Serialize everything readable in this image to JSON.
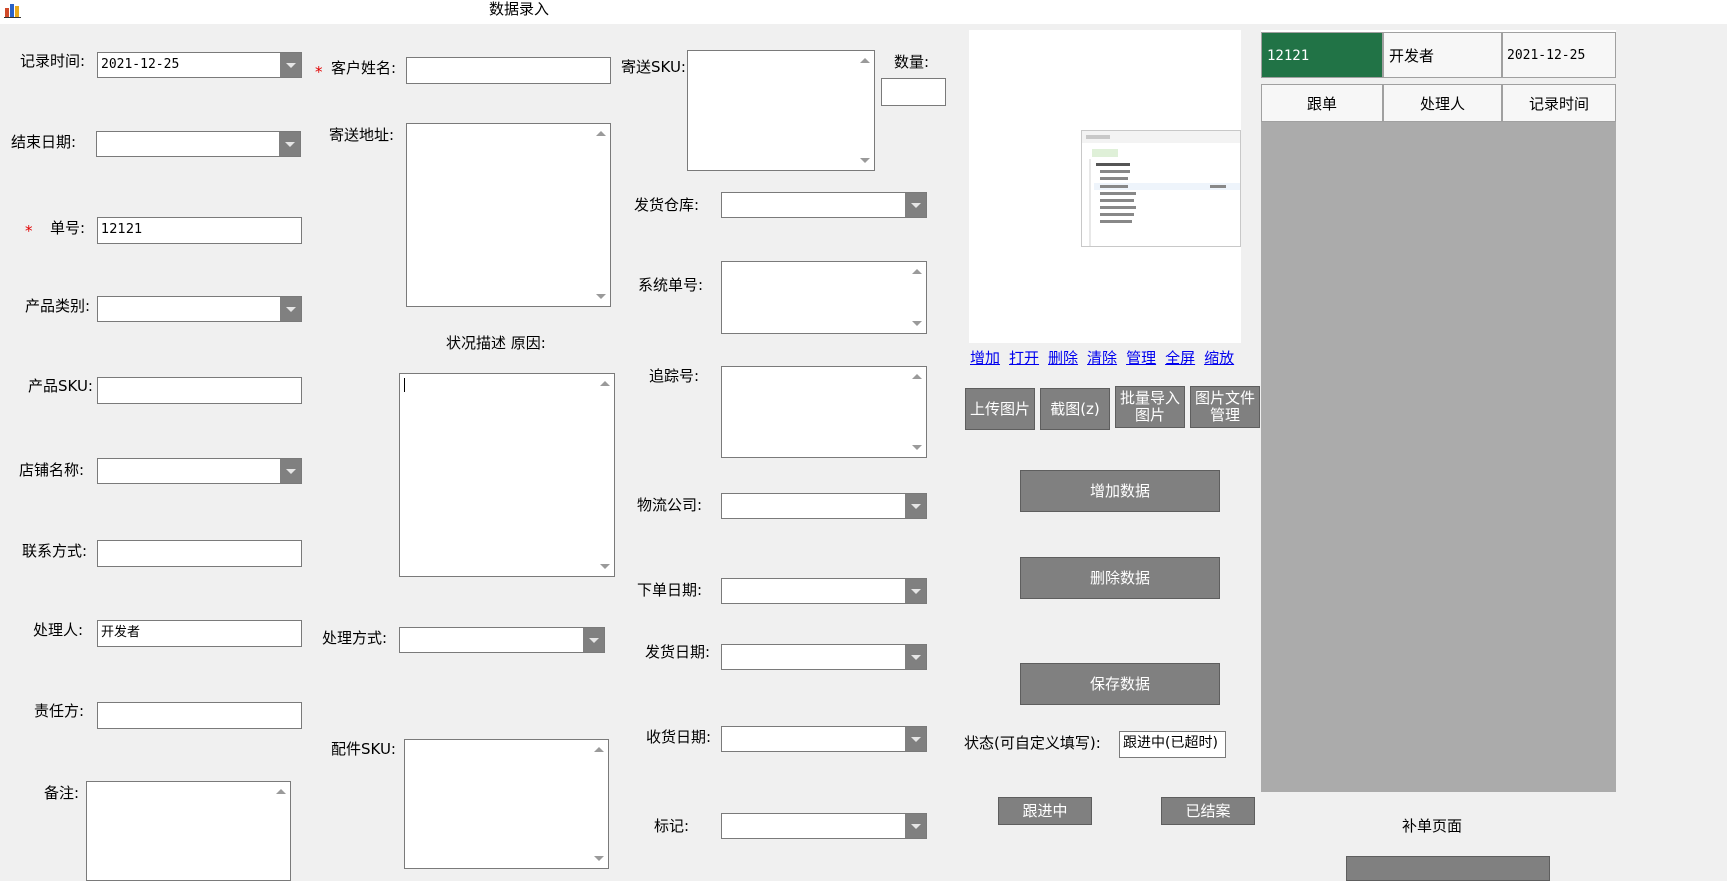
{
  "window": {
    "title": "数据录入"
  },
  "form": {
    "record_time": {
      "label": "记录时间:",
      "value": "2021-12-25"
    },
    "end_date": {
      "label": "结束日期:",
      "value": ""
    },
    "order_no": {
      "label": "单号:",
      "required_mark": "*",
      "value": "12121"
    },
    "product_category": {
      "label": "产品类别:",
      "value": ""
    },
    "product_sku": {
      "label": "产品SKU:",
      "value": ""
    },
    "shop_name": {
      "label": "店铺名称:",
      "value": ""
    },
    "contact": {
      "label": "联系方式:",
      "value": ""
    },
    "handler": {
      "label": "处理人:",
      "value": "开发者"
    },
    "responsible": {
      "label": "责任方:",
      "value": ""
    },
    "remark": {
      "label": "备注:"
    },
    "customer_name": {
      "label": "客户姓名:",
      "required_mark": "*",
      "value": ""
    },
    "ship_address": {
      "label": "寄送地址:"
    },
    "status_desc": {
      "label": "状况描述 原因:"
    },
    "handle_method": {
      "label": "处理方式:",
      "value": ""
    },
    "accessory_sku": {
      "label": "配件SKU:"
    },
    "ship_sku": {
      "label": "寄送SKU:"
    },
    "quantity": {
      "label": "数量:",
      "value": ""
    },
    "warehouse": {
      "label": "发货仓库:",
      "value": ""
    },
    "system_no": {
      "label": "系统单号:"
    },
    "tracking_no": {
      "label": "追踪号:"
    },
    "logistics": {
      "label": "物流公司:",
      "value": ""
    },
    "order_date": {
      "label": "下单日期:",
      "value": ""
    },
    "ship_date": {
      "label": "发货日期:",
      "value": ""
    },
    "receive_date": {
      "label": "收货日期:",
      "value": ""
    },
    "mark": {
      "label": "标记:",
      "value": ""
    }
  },
  "image_links": [
    "增加",
    "打开",
    "删除",
    "清除",
    "管理",
    "全屏",
    "缩放"
  ],
  "image_buttons": {
    "upload": "上传图片",
    "screenshot": "截图(z)",
    "batch_import": "批量导入图片",
    "file_manage": "图片文件管理"
  },
  "actions": {
    "add": "增加数据",
    "delete": "删除数据",
    "save": "保存数据"
  },
  "status": {
    "label": "状态(可自定义填写):",
    "value": "跟进中(已超时)",
    "following_button": "跟进中",
    "closed_button": "已结案"
  },
  "grid": {
    "header_row": [
      "12121",
      "开发者",
      "2021-12-25"
    ],
    "columns": [
      "跟单",
      "处理人",
      "记录时间"
    ]
  },
  "supplement": {
    "label": "补单页面"
  },
  "colors": {
    "button_bg": "#808080",
    "selected_cell": "#217346",
    "grid_bg": "#ababab",
    "required": "#e00000",
    "link": "#0000ee"
  }
}
